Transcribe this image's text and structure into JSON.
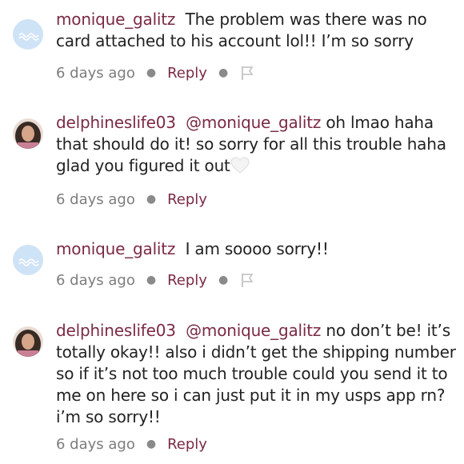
{
  "comments": [
    {
      "username": "monique_galitz",
      "mention": "",
      "text": "The problem was there was no card attached to his account lol!! I’m so sorry",
      "time": "6 days ago",
      "reply_label": "Reply",
      "has_flag": true,
      "avatar": "wave-placeholder-avatar",
      "heart": false
    },
    {
      "username": "delphineslife03",
      "mention": "@monique_galitz",
      "text": "oh lmao haha that should do it! so sorry for all this trouble haha glad you figured it out",
      "time": "6 days ago",
      "reply_label": "Reply",
      "has_flag": false,
      "avatar": "photo-avatar",
      "heart": true
    },
    {
      "username": "monique_galitz",
      "mention": "",
      "text": "I am soooo sorry!!",
      "time": "6 days ago",
      "reply_label": "Reply",
      "has_flag": true,
      "avatar": "wave-placeholder-avatar",
      "heart": false
    },
    {
      "username": "delphineslife03",
      "mention": "@monique_galitz",
      "text": "no don’t be! it’s totally okay!! also i didn’t get the shipping number so if it’s not too much trouble could you send it to me on here so i can just put it in my usps app rn? i’m so sorry!!",
      "time": "6 days ago",
      "reply_label": "Reply",
      "has_flag": false,
      "avatar": "photo-avatar",
      "heart": false
    }
  ],
  "colors": {
    "username": "#7a2a45",
    "time": "#7d7d7d",
    "placeholder_avatar": "#cfe3f7"
  },
  "icons": {
    "flag": "flag-icon",
    "heart": "white-heart-emoji",
    "separator": "dot"
  }
}
